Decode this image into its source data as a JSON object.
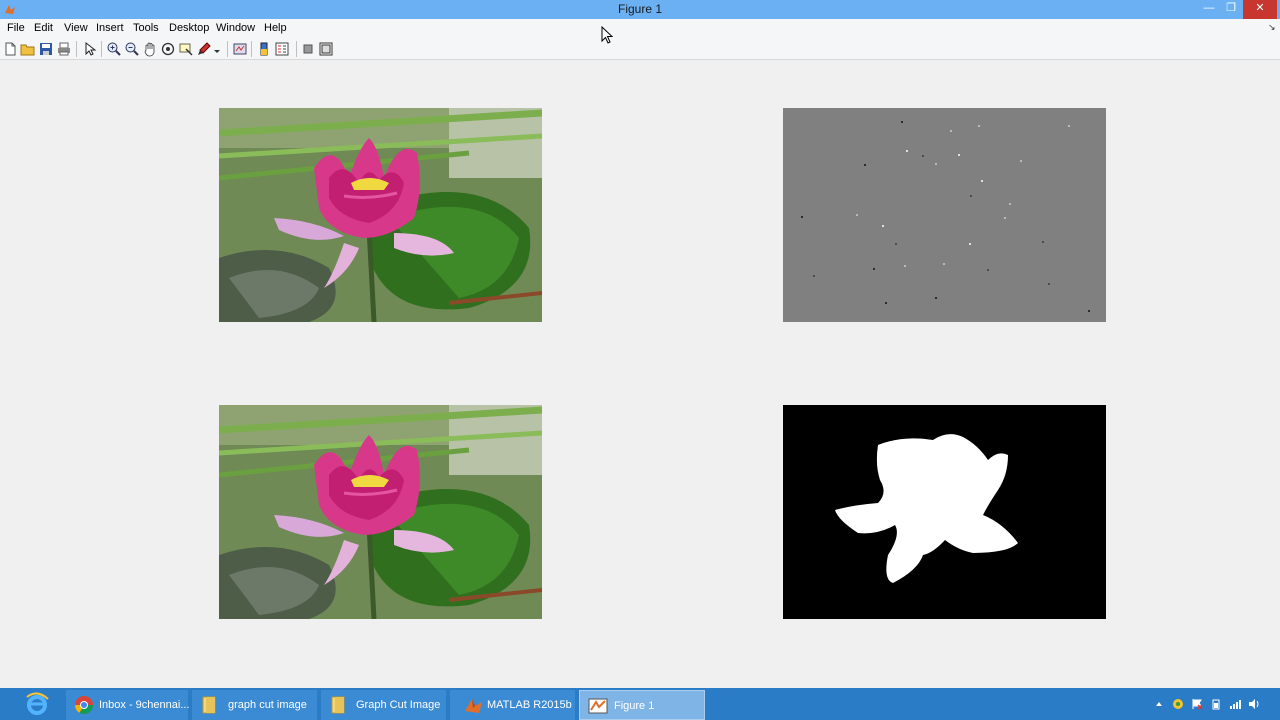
{
  "window": {
    "title": "Figure 1",
    "minimize": "—",
    "restore": "❐",
    "close": "✕"
  },
  "menu": {
    "items": [
      "File",
      "Edit",
      "View",
      "Insert",
      "Tools",
      "Desktop",
      "Window",
      "Help"
    ],
    "dock_arrow": "↘"
  },
  "toolbar": {
    "buttons": [
      "new-figure",
      "open-file",
      "save-figure",
      "print-figure",
      "edit-plot",
      "zoom-in",
      "zoom-out",
      "pan",
      "rotate-3d",
      "data-cursor",
      "brush",
      "link-plot",
      "insert-colorbar",
      "insert-legend",
      "hide-plot-tools",
      "show-plot-tools"
    ]
  },
  "figure": {
    "panels": [
      "original-image",
      "noise-image",
      "restored-image",
      "segmentation-mask"
    ]
  },
  "taskbar": {
    "items": [
      {
        "label": "Inbox - 9chennai...",
        "icon": "chrome-icon"
      },
      {
        "label": "graph cut image",
        "icon": "folder-icon"
      },
      {
        "label": "Graph Cut Image",
        "icon": "folder-icon"
      },
      {
        "label": "MATLAB R2015b",
        "icon": "matlab-icon"
      },
      {
        "label": "Figure 1",
        "icon": "figure-icon"
      }
    ]
  },
  "colors": {
    "titlebar": "#6ab0f3",
    "taskbar": "#2a7cc7",
    "close": "#c7372f",
    "flower_pink": "#d8388a",
    "leaf_green": "#3f7d2a"
  }
}
